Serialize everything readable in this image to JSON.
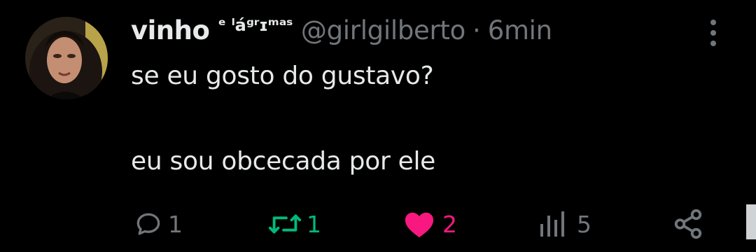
{
  "tweet": {
    "display_name": "vinho",
    "display_name_suffix": "ᵉ ˡáᵍʳɪᵐᵃˢ",
    "handle": "@girlgilberto",
    "separator": "·",
    "time": "6min",
    "text_line_1": "se eu gosto do gustavo?",
    "text_line_2": "eu sou obcecada por ele"
  },
  "actions": {
    "reply_count": "1",
    "retweet_count": "1",
    "like_count": "2",
    "views_count": "5"
  },
  "icons": {
    "avatar": "avatar-photo",
    "more": "more-vertical-icon",
    "reply": "reply-icon",
    "retweet": "retweet-icon",
    "like": "heart-filled-icon",
    "views": "views-icon",
    "share": "share-icon"
  },
  "colors": {
    "background": "#000000",
    "text": "#e7e9ea",
    "muted": "#71767b",
    "retweet_green": "#00ba7c",
    "like_pink": "#f91880"
  }
}
